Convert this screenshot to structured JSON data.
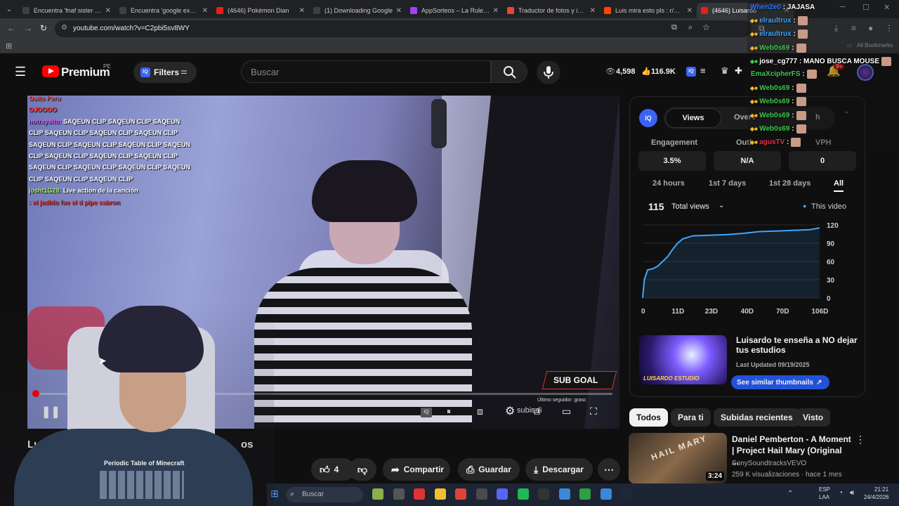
{
  "browser": {
    "tabs": [
      {
        "title": "Encuentra 'fnaf sister loca",
        "color": "#3c4043"
      },
      {
        "title": "Encuentra 'google exe ex",
        "color": "#3c4043"
      },
      {
        "title": "(4646) Pokémon Dian",
        "color": "#e62117"
      },
      {
        "title": "(1) Downloading Google",
        "color": "#3c4043"
      },
      {
        "title": "AppSorteos – La Ruleta d",
        "color": "#a142f4"
      },
      {
        "title": "Traductor de fotos y imág",
        "color": "#ea4335"
      },
      {
        "title": "Luis mira esto pls : r/OSIT",
        "color": "#ff4500"
      },
      {
        "title": "(4646) Luisardo",
        "color": "#e62117"
      }
    ],
    "url": "youtube.com/watch?v=C2pbi5sv8WY",
    "all_bookmarks": "All Bookmarks"
  },
  "youtube": {
    "logo_text": "Premium",
    "logo_country": "PE",
    "filters_label": "Filters",
    "search_placeholder": "Buscar",
    "view_count": "4,598",
    "like_count_header": "116.9K",
    "notif_count": "9+"
  },
  "video": {
    "chat_lines": [
      {
        "user": "Osito Peru",
        "msg": "",
        "color": "#ff5555"
      },
      {
        "user": "",
        "msg": "OJOOOO",
        "color": "#ff3333"
      },
      {
        "user": "notraysito:",
        "msg": "SAQEUN CLIP SAQEUN CLIP SAQEUN",
        "color": "#d05cff"
      },
      {
        "user": "",
        "msg": "CLIP SAQEUN CLIP SAQEUN CLIP SAQEUN CLIP",
        "color": ""
      },
      {
        "user": "",
        "msg": "SAQEUN CLIP SAQEUN CLIP SAQEUN CLIP SAQEUN",
        "color": ""
      },
      {
        "user": "",
        "msg": "CLIP SAQEUN CLIP SAQEUN CLIP SAQEUN CLIP",
        "color": ""
      },
      {
        "user": "",
        "msg": "SAQEUN CLIP SAQEUN CLIP SAQEUN CLIP SAQEUN",
        "color": ""
      },
      {
        "user": "",
        "msg": "CLIP SAQEUN CLIP SAQEUN CLIP",
        "color": ""
      },
      {
        "user": "josht1G28:",
        "msg": "Live action de la canción",
        "color": "#a9f060"
      },
      {
        "user": "",
        "msg": ": el jodido fue el d pipe cabron",
        "color": "#ff3333"
      }
    ],
    "sub_goal": "SUB GOAL",
    "sub_goal_line1": "Último seguidor: grasc",
    "sub_goal_line2": "subir di",
    "title_visible_start": "Lu",
    "title_visible_end": "os",
    "progress": 0.0
  },
  "actions": {
    "like_count": "4",
    "share": "Compartir",
    "save": "Guardar",
    "download": "Descargar"
  },
  "iq_panel": {
    "tab_views": "Views",
    "tab_overview": "Overv",
    "tab_third": "h",
    "engagement_label": "Engagement",
    "outliers_label": "Outl",
    "vph_label": "VPH",
    "engagement": "3.5%",
    "outliers": "N/A",
    "vph": "0",
    "ranges": [
      "24 hours",
      "1st 7 days",
      "1st 28 days",
      "All"
    ],
    "total": "115",
    "total_select": "Total views",
    "legend": "This video",
    "thumb_title": "Luisardo te enseña a NO dejar tus estudios",
    "last_updated": "Last Updated 09/19/2025",
    "similar": "See similar thumbnails",
    "thumb_text": "LUISARDO ESTUDIO"
  },
  "chart_data": {
    "type": "line",
    "x_ticks": [
      "0",
      "11D",
      "23D",
      "40D",
      "70D",
      "106D"
    ],
    "y_ticks": [
      "0",
      "30",
      "60",
      "90",
      "120"
    ],
    "ylim": [
      0,
      120
    ],
    "series": [
      {
        "name": "This video",
        "x": [
          0,
          1,
          3,
          6,
          9,
          12,
          15,
          18,
          21,
          24,
          30,
          40,
          50,
          60,
          70,
          80,
          90,
          100,
          106
        ],
        "y": [
          0,
          30,
          46,
          48,
          52,
          60,
          68,
          80,
          90,
          97,
          102,
          103,
          104,
          106,
          109,
          110,
          111,
          112,
          115
        ]
      }
    ]
  },
  "chips": [
    "Todos",
    "Para ti",
    "Subidas recientes",
    "Visto"
  ],
  "recommended": {
    "title": "Daniel Pemberton - A Moment | Project Hail Mary (Original ...",
    "channel": "SonySoundtracksVEVO",
    "meta": "259 K visualizaciones · hace 1 mes",
    "duration": "3:24",
    "thumb_text": "HAIL MARY"
  },
  "overlay_chat": [
    {
      "user": "When2e0",
      "msg": ": JAJASA",
      "color": "#2a7bff"
    },
    {
      "user": "elraultrux",
      "msg": ":",
      "color": "#3ea6ff"
    },
    {
      "user": "elraultrux",
      "msg": ":",
      "color": "#3ea6ff"
    },
    {
      "user": "Web0s69",
      "msg": ":",
      "color": "#3ec94f"
    },
    {
      "user": "jose_cg777",
      "msg": ": MANO BUSCA MOUSE",
      "color": "#ffffff"
    },
    {
      "user": "EmaXcipherFS",
      "msg": ":",
      "color": "#3ec94f"
    },
    {
      "user": "Web0s69",
      "msg": ":",
      "color": "#3ec94f"
    },
    {
      "user": "Web0s69",
      "msg": ":",
      "color": "#3ec94f"
    },
    {
      "user": "Web0s69",
      "msg": ":",
      "color": "#3ec94f"
    },
    {
      "user": "Web0s69",
      "msg": ":",
      "color": "#3ec94f"
    },
    {
      "user": "agusTV",
      "msg": ":",
      "color": "#e0334a"
    }
  ],
  "webcam_shirt": "Periodic Table of Minecraft",
  "taskbar": {
    "search": "Buscar",
    "lang1": "ESP",
    "lang2": "LAA",
    "time": "21:21",
    "date": "24/4/2026"
  }
}
